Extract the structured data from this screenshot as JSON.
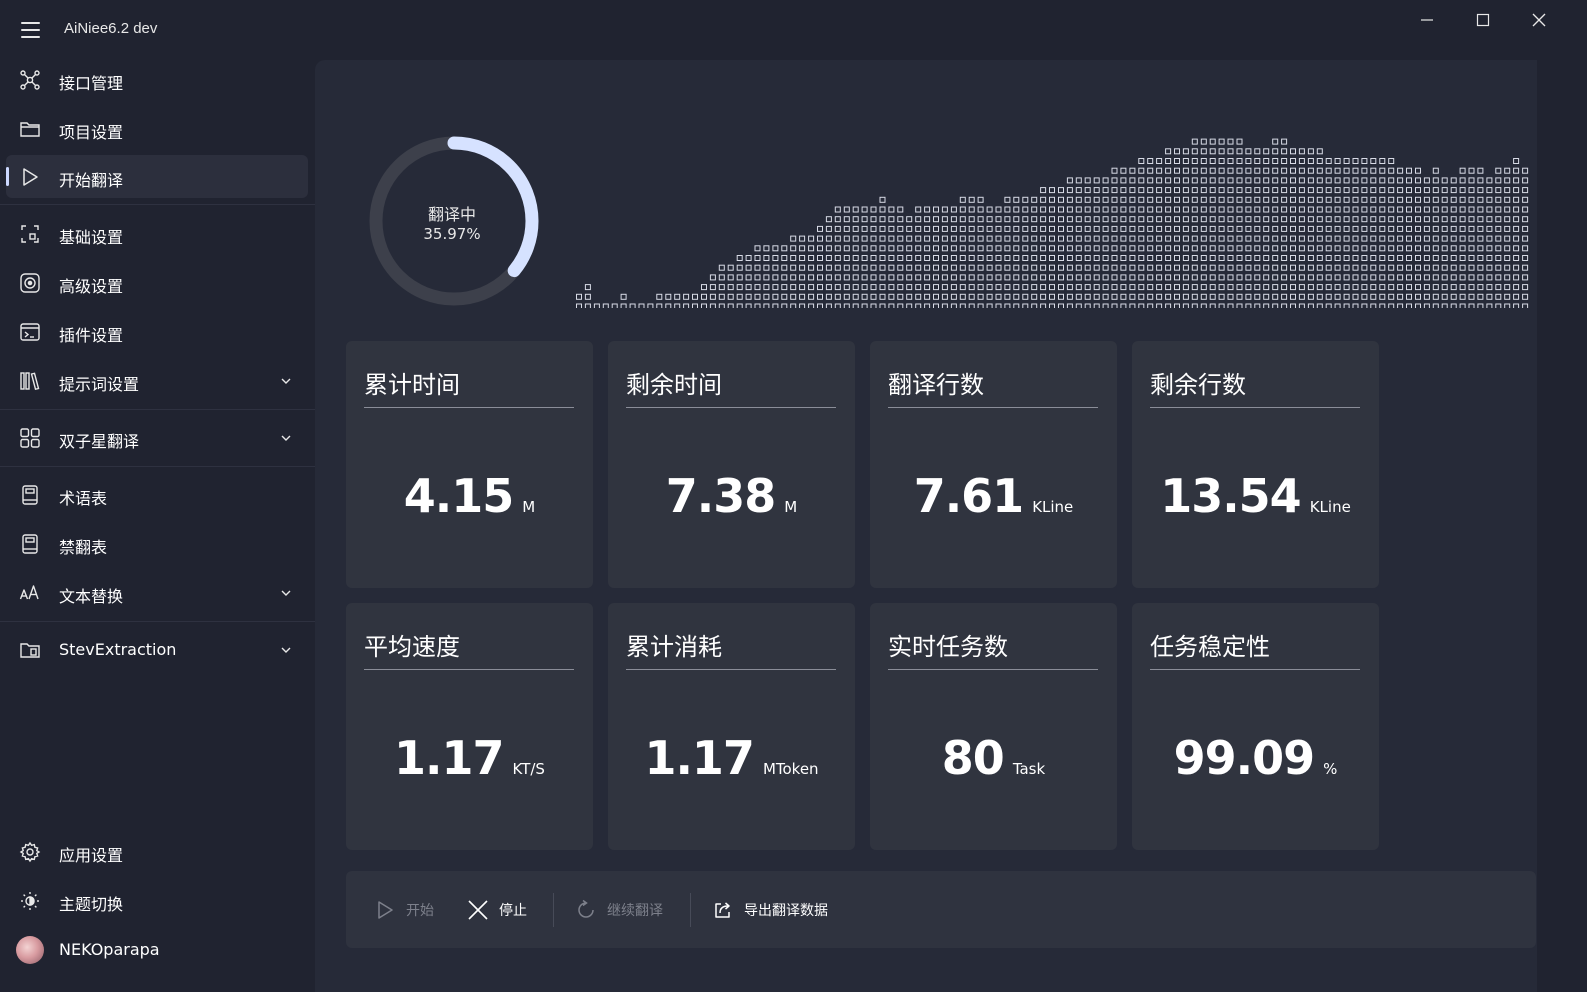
{
  "app": {
    "title": "AiNiee6.2 dev"
  },
  "nav": {
    "items": [
      {
        "label": "接口管理"
      },
      {
        "label": "项目设置"
      },
      {
        "label": "开始翻译"
      },
      {
        "label": "基础设置"
      },
      {
        "label": "高级设置"
      },
      {
        "label": "插件设置"
      },
      {
        "label": "提示词设置"
      },
      {
        "label": "双子星翻译"
      },
      {
        "label": "术语表"
      },
      {
        "label": "禁翻表"
      },
      {
        "label": "文本替换"
      },
      {
        "label": "StevExtraction"
      }
    ],
    "bottom": [
      {
        "label": "应用设置"
      },
      {
        "label": "主题切换"
      },
      {
        "label": "NEKOparapa"
      }
    ],
    "active_index": 2
  },
  "progress": {
    "status": "翻译中",
    "percent_text": "35.97%",
    "fraction": 0.3597,
    "colors": {
      "track": "#3d404b",
      "fill": "#d6e2ff"
    }
  },
  "wave": {
    "levels": [
      1,
      2,
      0,
      0,
      0,
      1,
      0,
      0,
      0,
      1,
      1,
      1,
      1,
      1,
      2,
      3,
      4,
      4,
      5,
      5,
      6,
      6,
      6,
      6,
      7,
      7,
      7,
      8,
      9,
      10,
      10,
      10,
      10,
      10,
      11,
      10,
      10,
      9,
      10,
      10,
      10,
      10,
      10,
      11,
      11,
      11,
      10,
      10,
      11,
      11,
      11,
      11,
      12,
      12,
      12,
      13,
      13,
      13,
      13,
      13,
      14,
      14,
      14,
      15,
      15,
      15,
      16,
      16,
      16,
      17,
      17,
      17,
      17,
      17,
      17,
      16,
      16,
      16,
      17,
      17,
      16,
      16,
      16,
      16,
      15,
      15,
      15,
      15,
      15,
      15,
      15,
      15,
      14,
      14,
      14,
      13,
      14,
      13,
      13,
      14,
      14,
      14,
      13,
      14,
      14,
      15,
      14
    ],
    "max_level": 19
  },
  "stats": [
    {
      "title": "累计时间",
      "value": "4.15",
      "unit": "M"
    },
    {
      "title": "剩余时间",
      "value": "7.38",
      "unit": "M"
    },
    {
      "title": "翻译行数",
      "value": "7.61",
      "unit": "KLine"
    },
    {
      "title": "剩余行数",
      "value": "13.54",
      "unit": "KLine"
    },
    {
      "title": "平均速度",
      "value": "1.17",
      "unit": "KT/S"
    },
    {
      "title": "累计消耗",
      "value": "1.17",
      "unit": "MToken"
    },
    {
      "title": "实时任务数",
      "value": "80",
      "unit": "Task"
    },
    {
      "title": "任务稳定性",
      "value": "99.09",
      "unit": "%"
    }
  ],
  "toolbar": {
    "start": "开始",
    "stop": "停止",
    "continue": "继续翻译",
    "export": "导出翻译数据"
  },
  "icons": {
    "menu": "hamburger-icon",
    "minimize": "minimize-icon",
    "maximize": "maximize-icon",
    "close": "close-icon"
  }
}
